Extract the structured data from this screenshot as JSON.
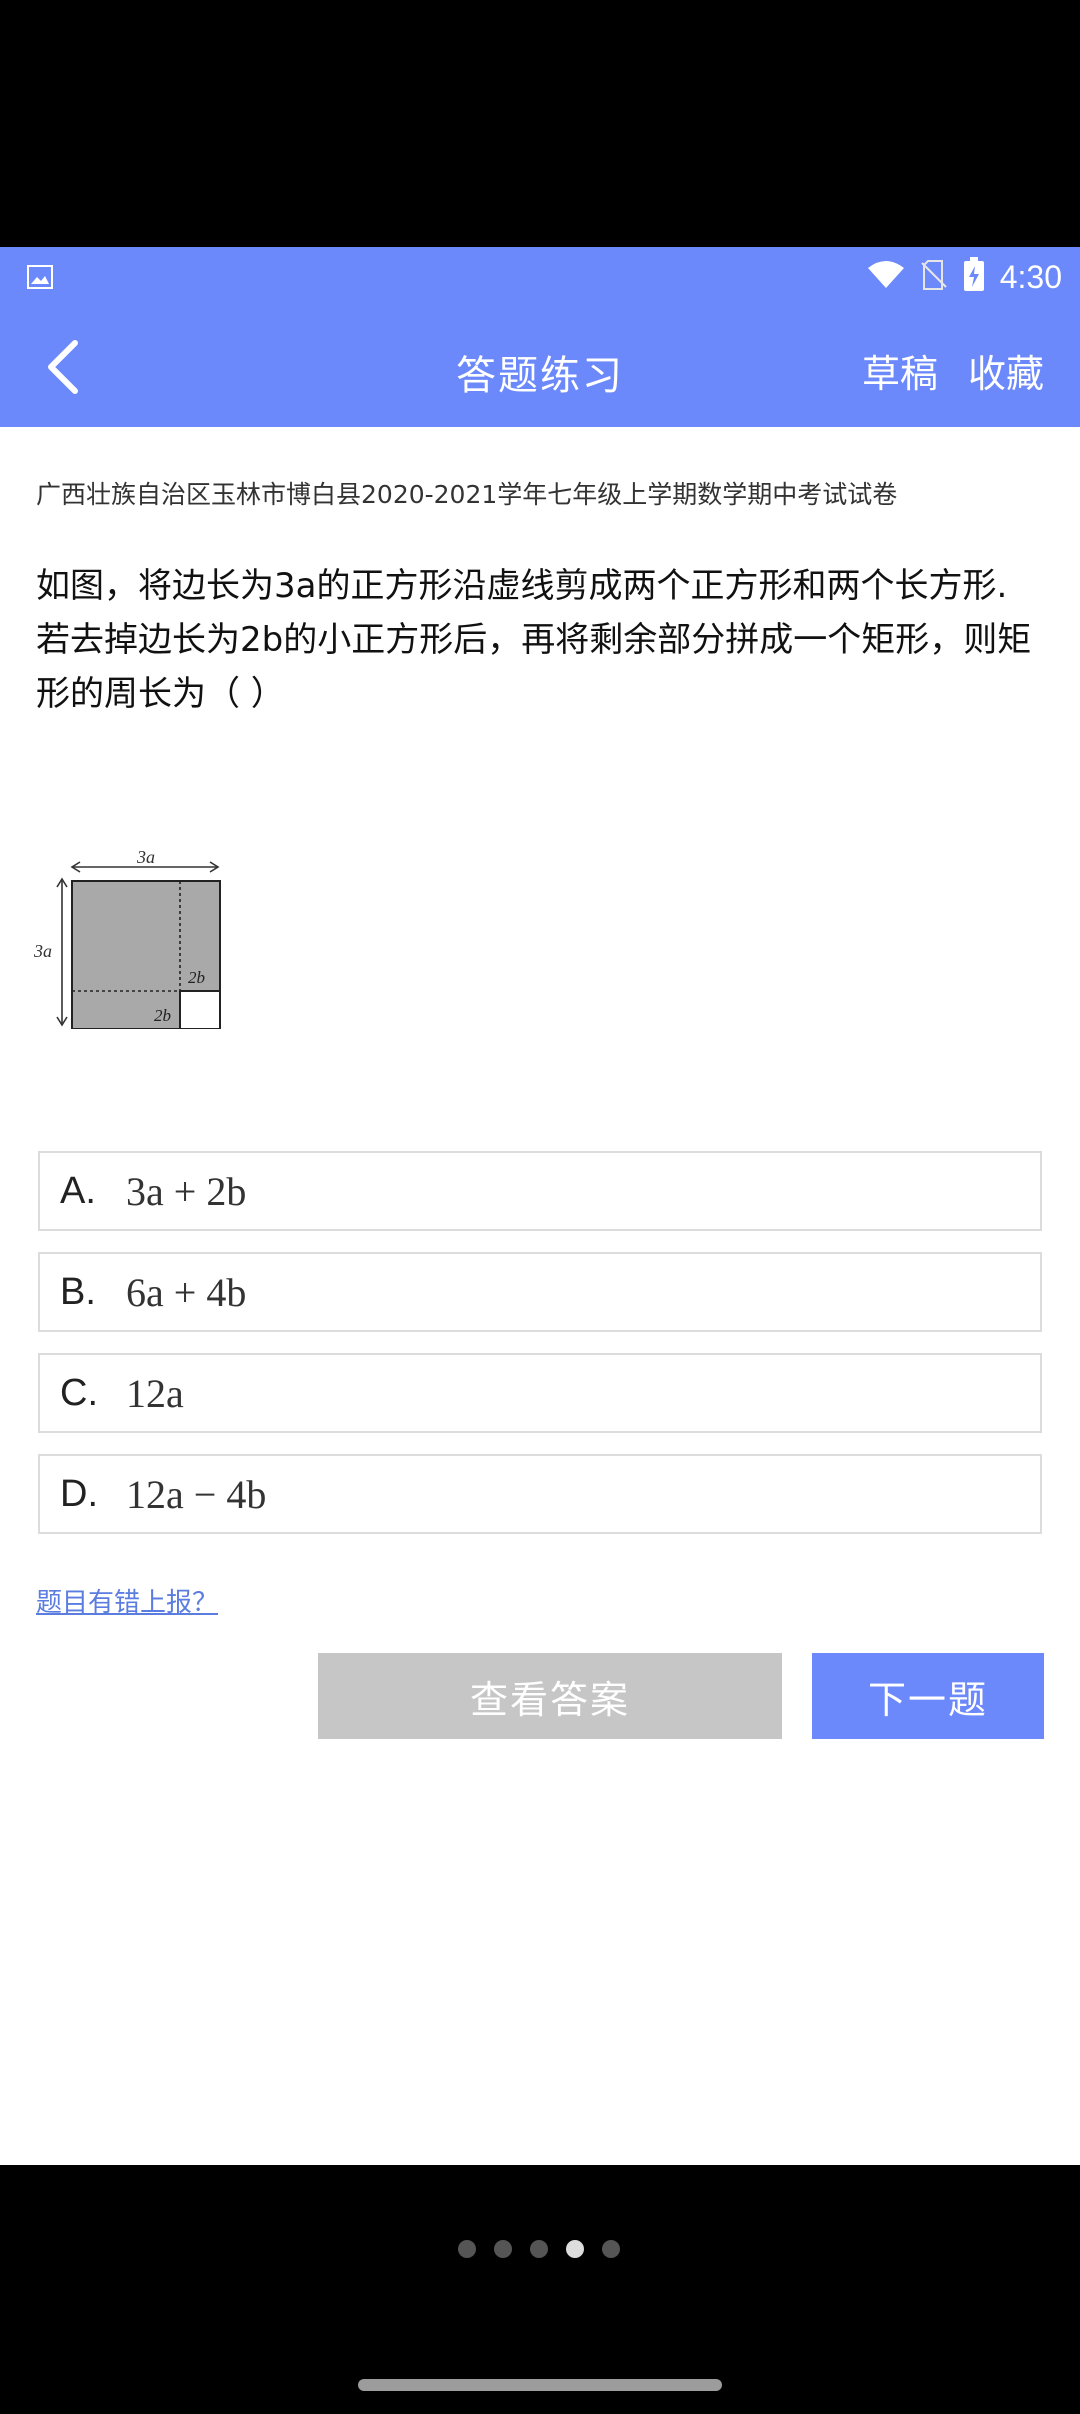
{
  "status_bar": {
    "time": "4:30",
    "icons": [
      "image-icon",
      "wifi-icon",
      "no-sim-icon",
      "battery-charging-icon"
    ]
  },
  "app_bar": {
    "title": "答题练习",
    "actions": [
      "草稿",
      "收藏"
    ]
  },
  "question": {
    "source": "广西壮族自治区玉林市博白县2020-2021学年七年级上学期数学期中考试试卷",
    "text": "如图，将边长为3a的正方形沿虚线剪成两个正方形和两个长方形.若去掉边长为2b的小正方形后，再将剩余部分拼成一个矩形，则矩形的周长为（    ）",
    "figure": {
      "top_label": "3a",
      "left_label": "3a",
      "inner_label_right": "2b",
      "inner_label_bottom": "2b"
    },
    "options": [
      {
        "letter": "A.",
        "math": "3a + 2b"
      },
      {
        "letter": "B.",
        "math": "6a + 4b"
      },
      {
        "letter": "C.",
        "math": "12a"
      },
      {
        "letter": "D.",
        "math": "12a − 4b"
      }
    ]
  },
  "links": {
    "report": "题目有错上报？"
  },
  "buttons": {
    "view_answer": "查看答案",
    "next": "下一题"
  },
  "pager": {
    "count": 5,
    "active_index": 3
  },
  "colors": {
    "primary": "#6c89fb",
    "disabled": "#c6c6c6",
    "link": "#5b7de0"
  }
}
